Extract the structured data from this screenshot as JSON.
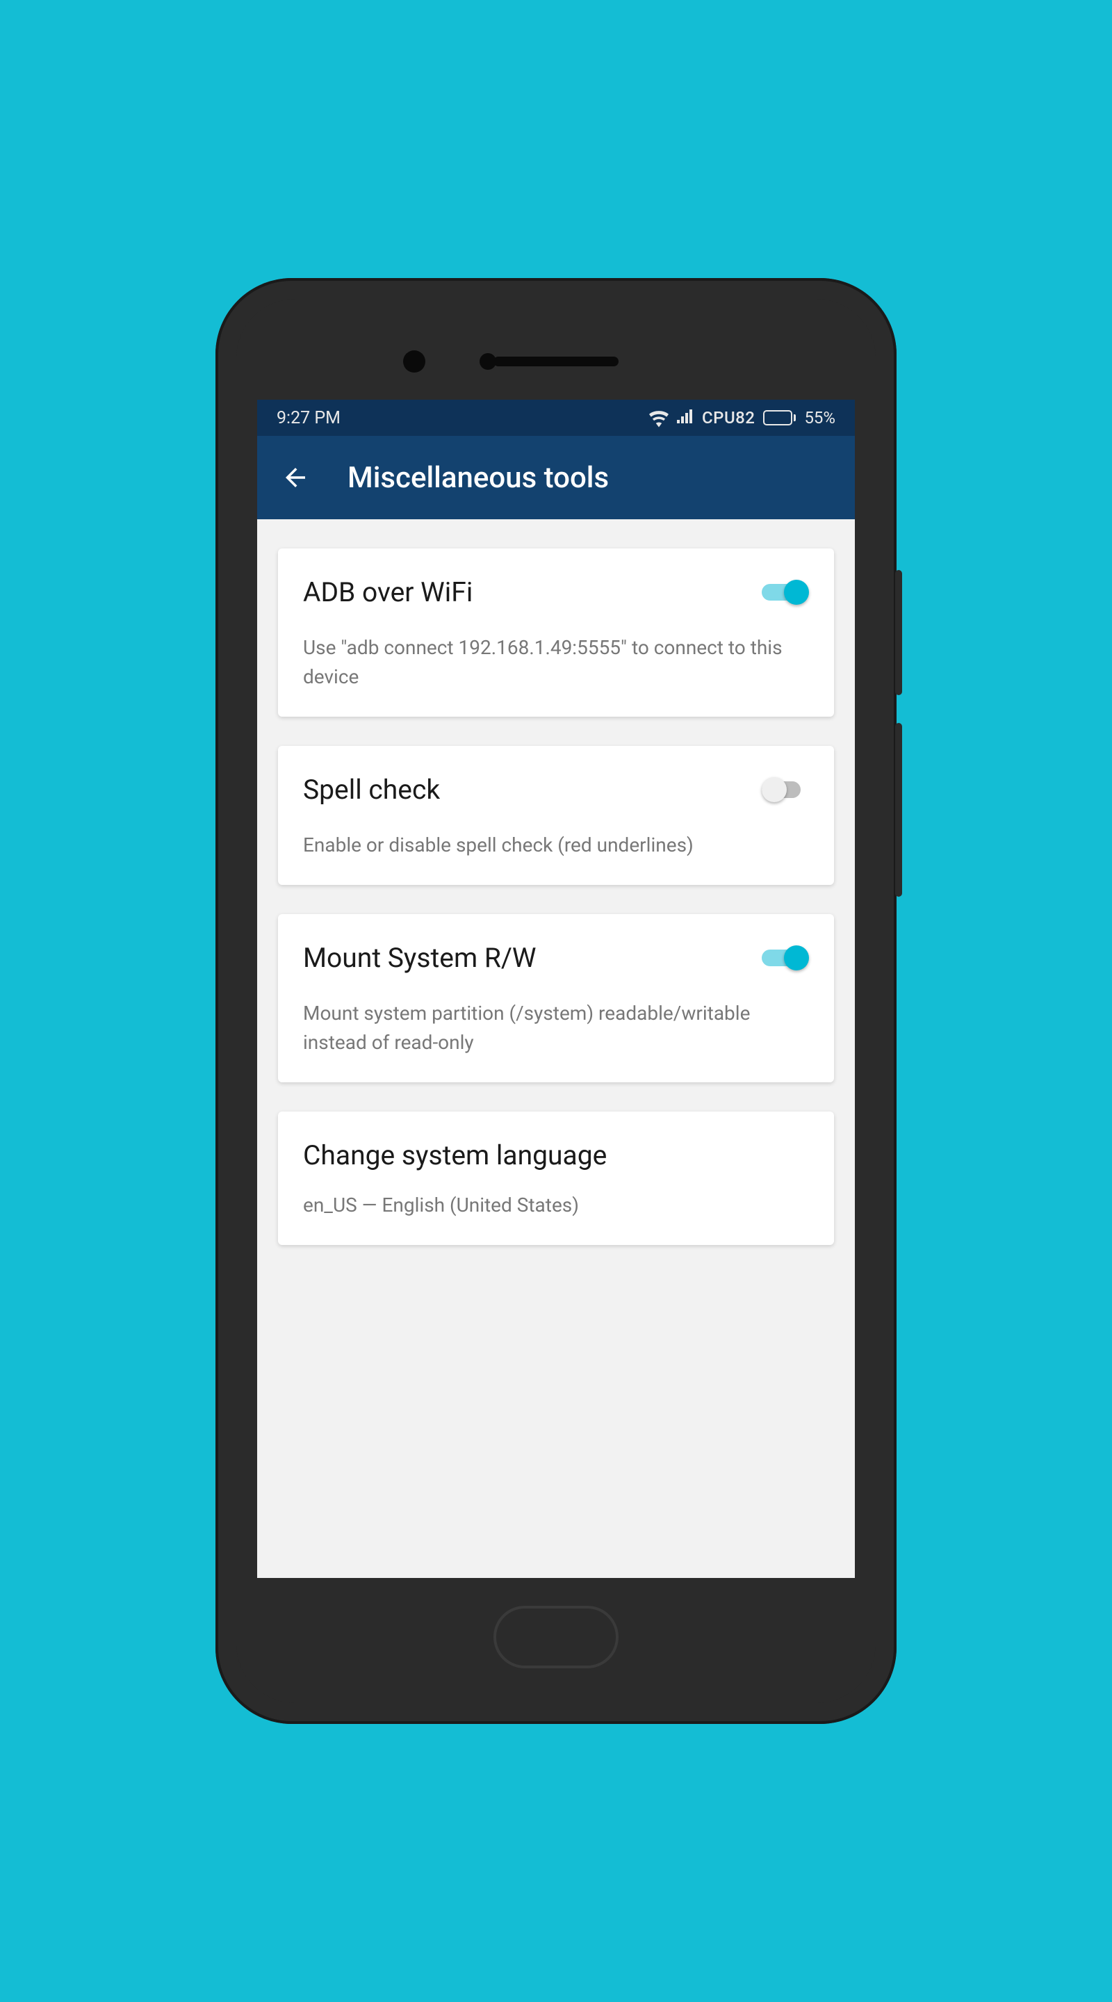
{
  "status": {
    "time": "9:27 PM",
    "cpu_label": "CPU82",
    "battery_percent": "55%"
  },
  "appbar": {
    "title": "Miscellaneous tools"
  },
  "cards": {
    "adb": {
      "title": "ADB over WiFi",
      "description": "Use \"adb connect 192.168.1.49:5555\" to connect to this device"
    },
    "spell": {
      "title": "Spell check",
      "description": "Enable or disable spell check (red underlines)"
    },
    "mount": {
      "title": "Mount System R/W",
      "description": "Mount system partition (/system) readable/writable instead of read-only"
    },
    "lang": {
      "title": "Change system language",
      "description": "en_US — English (United States)"
    }
  }
}
